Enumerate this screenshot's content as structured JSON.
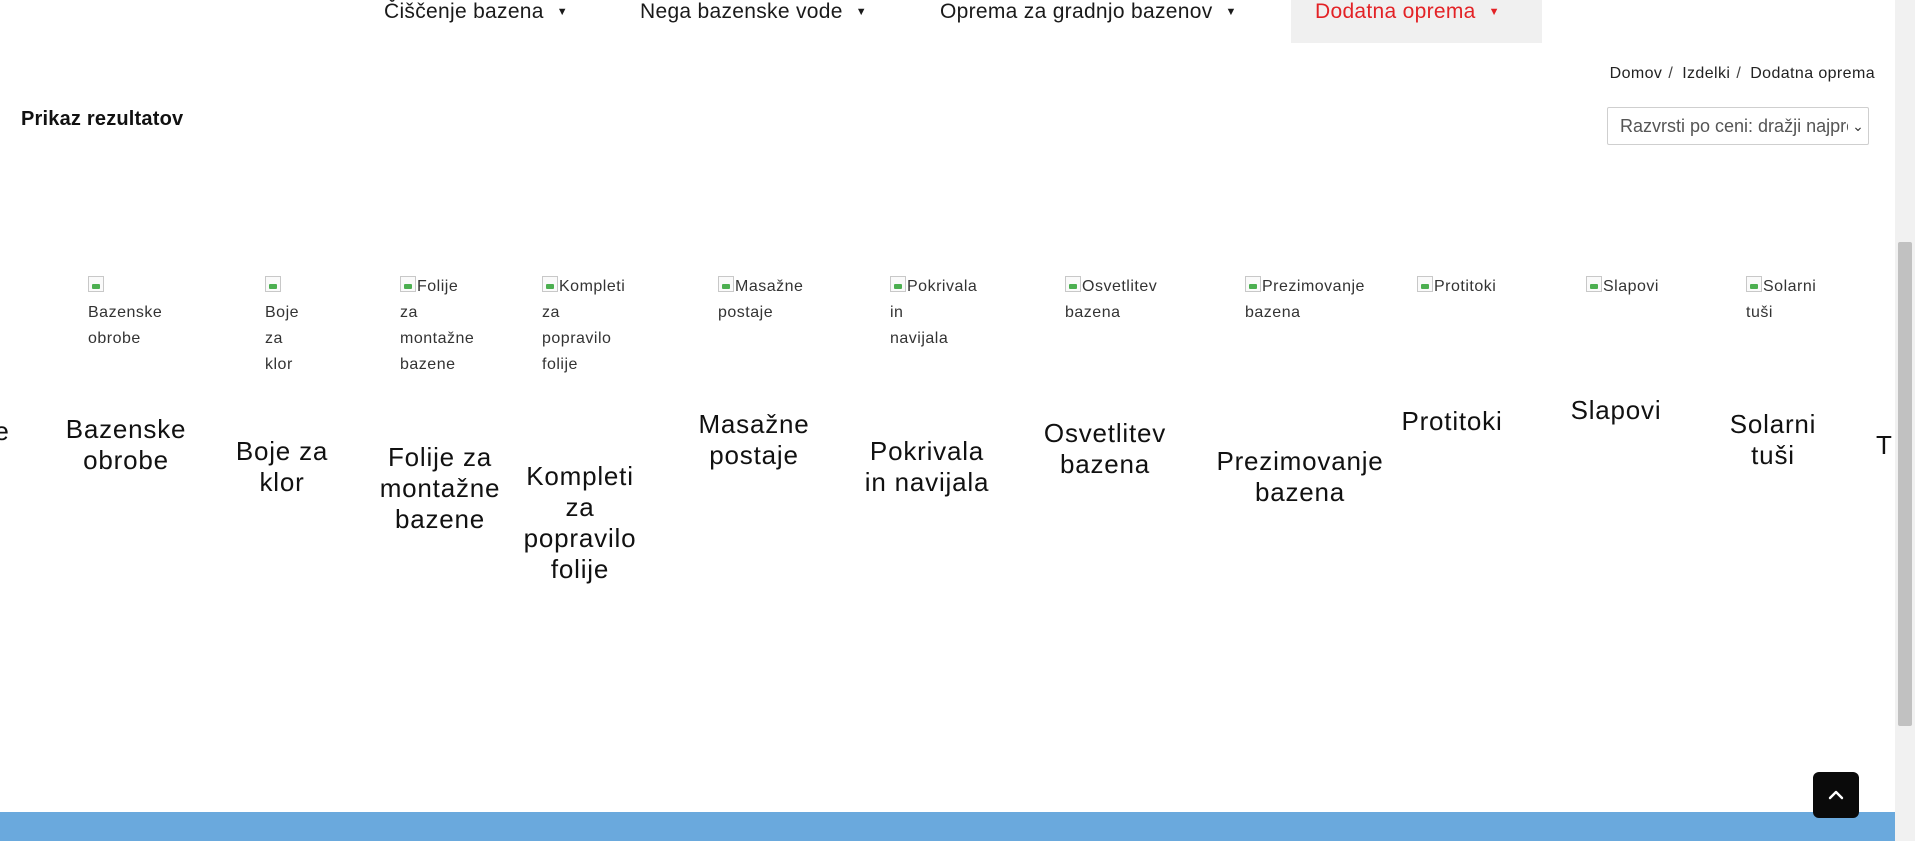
{
  "nav": {
    "items": [
      {
        "label": "Čiščenje bazena"
      },
      {
        "label": "Nega bazenske vode"
      },
      {
        "label": "Oprema za gradnjo bazenov"
      },
      {
        "label": "Dodatna oprema"
      }
    ]
  },
  "breadcrumb": [
    "Domov",
    "Izdelki",
    "Dodatna oprema"
  ],
  "results_label": "Prikaz rezultatov",
  "sort": {
    "selected": "Razvrsti po ceni: dražji najprej"
  },
  "categories": [
    {
      "alt": "Bazenske\nobrobe",
      "title": "Bazenske\nobrobe"
    },
    {
      "alt": "Boje\nza\nklor",
      "title": "Boje za\nklor"
    },
    {
      "alt": "Folije\nza\nmontažne\nbazene",
      "title": "Folije za\nmontažne\nbazene"
    },
    {
      "alt": "Kompleti\nza\npopravilo\nfolije",
      "title": "Kompleti\nza\npopravilo\nfolije"
    },
    {
      "alt": "Masažne\npostaje",
      "title": "Masažne\npostaje"
    },
    {
      "alt": "Pokrivala\nin\nnavijala",
      "title": "Pokrivala\nin navijala"
    },
    {
      "alt": "Osvetlitev\nbazena",
      "title": "Osvetlitev\nbazena"
    },
    {
      "alt": "Prezimovanje\nbazena",
      "title": "Prezimovanje\nbazena"
    },
    {
      "alt": "Protitoki",
      "title": "Protitoki"
    },
    {
      "alt": "Slapovi",
      "title": "Slapovi"
    },
    {
      "alt": "Solarni\ntuši",
      "title": "Solarni\ntuši"
    }
  ],
  "partial_left_title": "e",
  "partial_right_title": "T",
  "colors": {
    "accent": "#e32226",
    "footer": "#6aa9dd"
  },
  "icons": {
    "caret": "caret-down-icon",
    "to_top": "arrow-up-icon",
    "image": "broken-image-icon"
  }
}
